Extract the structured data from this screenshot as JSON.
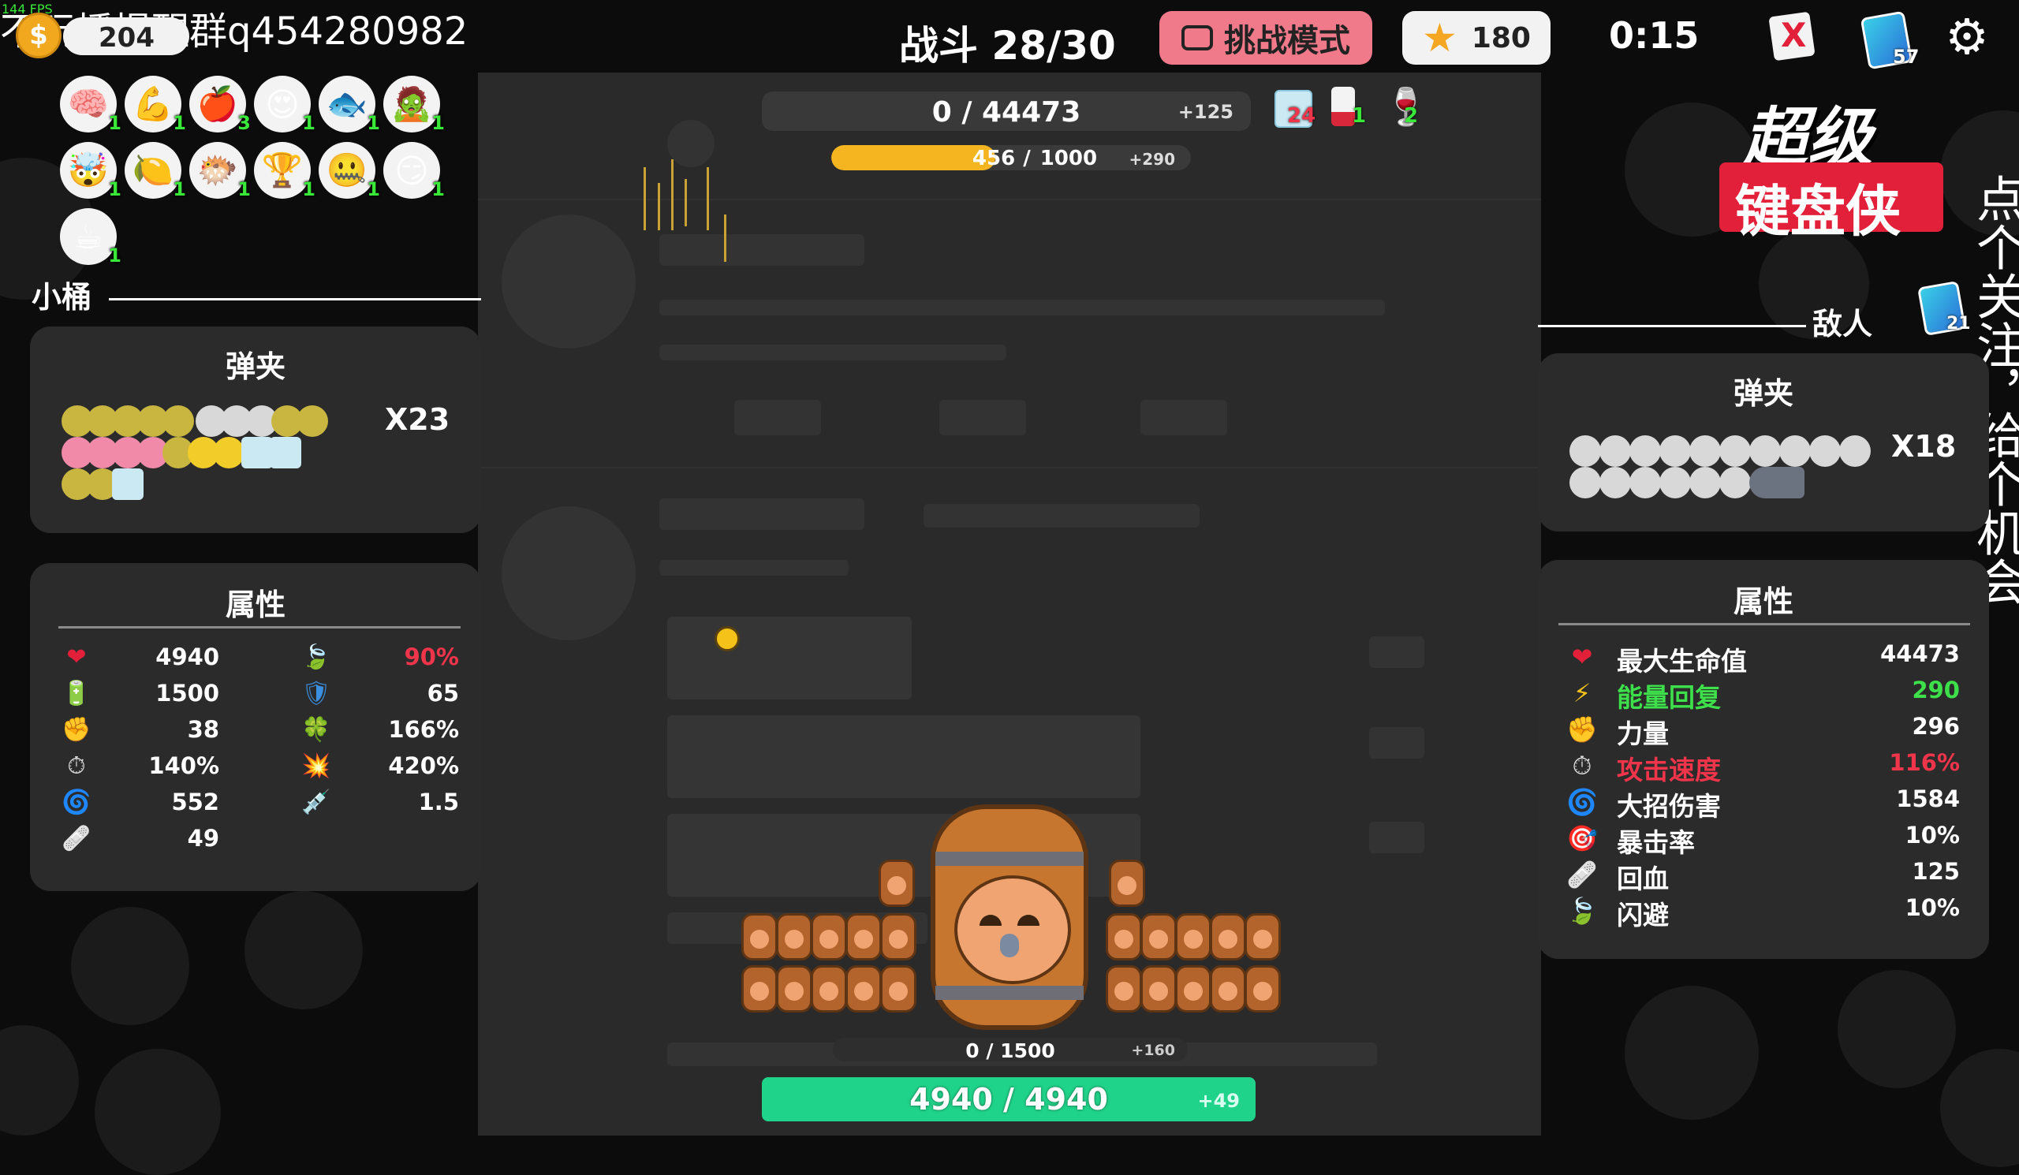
{
  "watermark": "不玩播提醒群q454280982",
  "fps": "144 FPS",
  "top": {
    "coins": "204",
    "battle": "战斗 28/30",
    "challenge_mode": "挑战模式",
    "stars": "180",
    "timer": "0:15",
    "cards_badge": "57"
  },
  "enemy_hp": {
    "text": "0 / 44473",
    "regen": "+125",
    "icons": [
      {
        "icon": "ice-cube",
        "count": "24"
      },
      {
        "icon": "blood-bag",
        "count": "1"
      },
      {
        "icon": "wine-glass",
        "count": "2"
      }
    ]
  },
  "enemy_energy": {
    "current": "456",
    "max": "1000",
    "regen": "+290",
    "fill": 0.456
  },
  "player_energy": {
    "text": "0 / 1500",
    "regen": "+160"
  },
  "player_hp": {
    "text": "4940 / 4940",
    "regen": "+49",
    "fill": 1.0
  },
  "logo": {
    "line1": "超级",
    "line2": "键盘侠"
  },
  "side_text": {
    "col1": "点个关注，",
    "col2": "给个机会"
  },
  "player": {
    "name": "小桶",
    "items": [
      {
        "icon": "brain",
        "emoji": "🧠",
        "count": "1"
      },
      {
        "icon": "muscle-arm",
        "emoji": "💪",
        "count": "1"
      },
      {
        "icon": "apple",
        "emoji": "🍎",
        "count": "3"
      },
      {
        "icon": "heart-eyes",
        "emoji": "😍",
        "count": "1"
      },
      {
        "icon": "fish",
        "emoji": "🐟",
        "count": "1"
      },
      {
        "icon": "zombie",
        "emoji": "🧟",
        "count": "1"
      },
      {
        "icon": "exploding-head",
        "emoji": "🤯",
        "count": "1"
      },
      {
        "icon": "lemon",
        "emoji": "🍋",
        "count": "1"
      },
      {
        "icon": "blowfish",
        "emoji": "🐡",
        "count": "1"
      },
      {
        "icon": "trophy",
        "emoji": "🏆",
        "count": "1"
      },
      {
        "icon": "zipper-face",
        "emoji": "🤐",
        "count": "1"
      },
      {
        "icon": "smirk-face",
        "emoji": "😏",
        "count": "1"
      },
      {
        "icon": "coffee",
        "emoji": "☕",
        "count": "1"
      }
    ],
    "magazine_title": "弹夹",
    "magazine_count": "X23",
    "attributes_title": "属性",
    "stats_left": [
      {
        "icon": "heart-icon",
        "glyph": "❤",
        "color": "#e3203a",
        "value": "4940",
        "value_color": "#ffffff"
      },
      {
        "icon": "battery-icon",
        "glyph": "🔋",
        "color": "#56c24a",
        "value": "1500",
        "value_color": "#ffffff"
      },
      {
        "icon": "fist-icon",
        "glyph": "✊",
        "color": "#f5c21a",
        "value": "38",
        "value_color": "#ffffff"
      },
      {
        "icon": "stopwatch-icon",
        "glyph": "⏱",
        "color": "#dddddd",
        "value": "140%",
        "value_color": "#ffffff"
      },
      {
        "icon": "spiral-icon",
        "glyph": "🌀",
        "color": "#4a5ce0",
        "value": "552",
        "value_color": "#ffffff"
      },
      {
        "icon": "bandage-icon",
        "glyph": "🩹",
        "color": "#e8a483",
        "value": "49",
        "value_color": "#ffffff"
      }
    ],
    "stats_right": [
      {
        "icon": "leaf-icon",
        "glyph": "🍃",
        "color": "#6fbf4a",
        "value": "90%",
        "value_color": "#f0354a"
      },
      {
        "icon": "shield-icon",
        "glyph": "🛡",
        "color": "#3a8fe0",
        "value": "65",
        "value_color": "#ffffff"
      },
      {
        "icon": "clover-icon",
        "glyph": "🍀",
        "color": "#3fbf4a",
        "value": "166%",
        "value_color": "#ffffff"
      },
      {
        "icon": "explosion-icon",
        "glyph": "💥",
        "color": "#f5c21a",
        "value": "420%",
        "value_color": "#ffffff"
      },
      {
        "icon": "syringe-icon",
        "glyph": "💉",
        "color": "#c74ad6",
        "value": "1.5",
        "value_color": "#ffffff"
      }
    ]
  },
  "enemy": {
    "name": "敌人",
    "cards_badge": "21",
    "magazine_title": "弹夹",
    "magazine_count": "X18",
    "attributes_title": "属性",
    "stats": [
      {
        "icon": "heart-icon",
        "glyph": "❤",
        "icon_color": "#e3203a",
        "label": "最大生命值",
        "value": "44473",
        "color": "#ffffff"
      },
      {
        "icon": "lightning-icon",
        "glyph": "⚡",
        "icon_color": "#f5c21a",
        "label": "能量回复",
        "value": "290",
        "color": "#3de04a"
      },
      {
        "icon": "fist-icon",
        "glyph": "✊",
        "icon_color": "#f5c21a",
        "label": "力量",
        "value": "296",
        "color": "#ffffff"
      },
      {
        "icon": "stopwatch-icon",
        "glyph": "⏱",
        "icon_color": "#dddddd",
        "label": "攻击速度",
        "value": "116%",
        "color": "#f0354a"
      },
      {
        "icon": "spiral-icon",
        "glyph": "🌀",
        "icon_color": "#4a5ce0",
        "label": "大招伤害",
        "value": "1584",
        "color": "#ffffff"
      },
      {
        "icon": "target-icon",
        "glyph": "🎯",
        "icon_color": "#e3203a",
        "label": "暴击率",
        "value": "10%",
        "color": "#ffffff"
      },
      {
        "icon": "bandage-icon",
        "glyph": "🩹",
        "icon_color": "#e8a483",
        "label": "回血",
        "value": "125",
        "color": "#ffffff"
      },
      {
        "icon": "leaf-icon",
        "glyph": "🍃",
        "icon_color": "#6fbf4a",
        "label": "闪避",
        "value": "10%",
        "color": "#ffffff"
      }
    ]
  },
  "colors": {
    "accent_pink": "#f07a8a",
    "hp_green": "#1fd38a",
    "energy_yellow": "#f5b521",
    "bg": "#0c0c0c",
    "panel": "#2b2b2b",
    "arena": "#2a2a2a"
  }
}
